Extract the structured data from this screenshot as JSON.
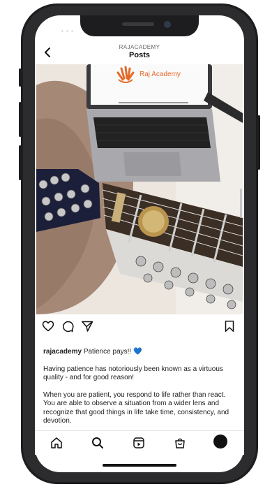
{
  "header": {
    "account": "RAJACADEMY",
    "title": "Posts"
  },
  "post": {
    "laptop_brand": "Raj Academy",
    "caption_user": "rajacademy",
    "caption_headline": " Patience pays!! 💙",
    "paragraphs": [
      "Having patience has notoriously been known as a virtuous quality - and for good reason!",
      "When you are patient, you respond to life rather than react. You are able to observe a situation from a wider lens and recognize that good things in life take time, consistency, and devotion."
    ]
  },
  "icons": {
    "back": "chevron-left-icon",
    "like": "heart-icon",
    "comment": "comment-icon",
    "share": "send-icon",
    "save": "bookmark-icon",
    "nav": [
      "home-icon",
      "search-icon",
      "reels-icon",
      "shop-icon",
      "profile-avatar"
    ]
  },
  "colors": {
    "brand_orange": "#e56a2a",
    "heart_blue": "#2f7de1"
  }
}
